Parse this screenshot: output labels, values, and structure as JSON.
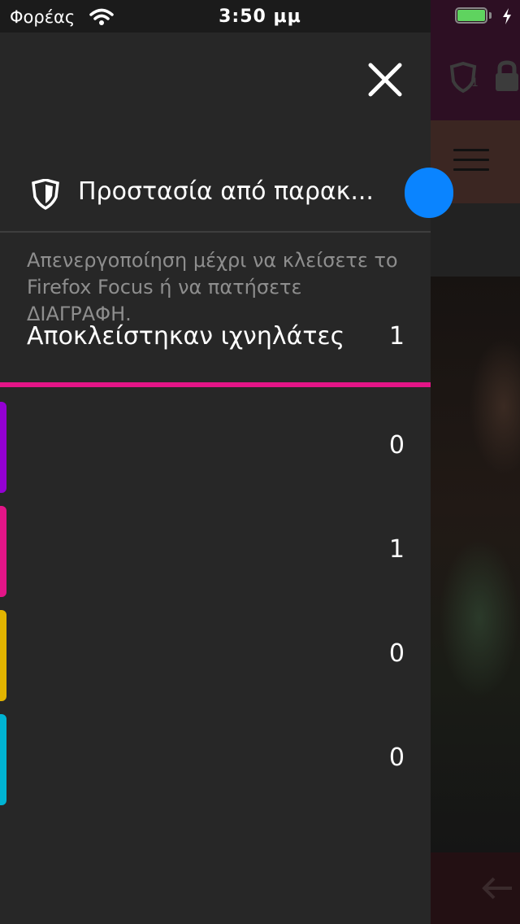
{
  "status_bar": {
    "carrier": "Φορέας",
    "time": "3:50 μμ",
    "battery_level": 1.0
  },
  "panel": {
    "close_icon": "close-icon",
    "tracking_protection": {
      "label": "Προστασία από παρακ...",
      "enabled": true,
      "icon": "shield-icon"
    },
    "description": "Απενεργοποίηση μέχρι να κλείσετε το Firefox Focus ή να πατήσετε ΔΙΑΓΡΑΦΗ.",
    "trackers_blocked": {
      "label": "Αποκλείστηκαν ιχνηλάτες",
      "count": "1"
    },
    "categories": [
      {
        "color": "#9400d3",
        "count": "0"
      },
      {
        "color": "#e31587",
        "count": "1"
      },
      {
        "color": "#e2b400",
        "count": "0"
      },
      {
        "color": "#00b4d3",
        "count": "0"
      }
    ]
  },
  "colors": {
    "panel_bg": "#272727",
    "accent_pink": "#e31587",
    "toggle_blue": "#0a84ff"
  }
}
